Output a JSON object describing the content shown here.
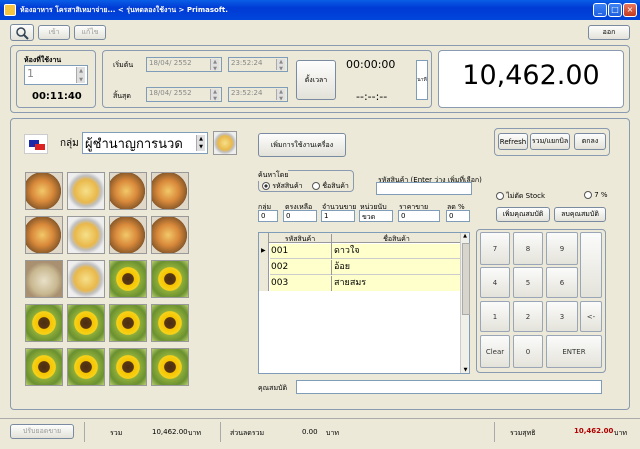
{
  "window": {
    "title": "ห้องอาหาร โครสาสิเหมาจ่าย... < รุ่นทดลองใช้งาน > Primasoft."
  },
  "toolbar": {
    "search_icon": "magnifier-icon",
    "btn1": "เข้า",
    "btn2": "แก้ไข",
    "exit": "ออก"
  },
  "room": {
    "label": "ห้องที่ใช้งาน",
    "value": "1",
    "time": "00:11:40"
  },
  "times": {
    "start_label": "เริ่มต้น",
    "start_date": "18/04/ 2552",
    "start_time": "23:52:24",
    "end_label": "สิ้นสุด",
    "end_date": "18/04/ 2552",
    "end_time": "23:52:24",
    "start_btn": "ตั้งเวลา",
    "elapsed": "00:00:00",
    "remain": "--:--:--",
    "unit": "นาที"
  },
  "total_display": "10,462.00",
  "group": {
    "label": "กลุ่ม",
    "value": "ผู้ชำนาญการนวด"
  },
  "service_btn": "เพิ่มการใช้งานเครื่อง",
  "right_btns": [
    "Refresh",
    "รวม/แยกบิล",
    "ตกลง"
  ],
  "search": {
    "label": "ค้นหาโดย",
    "opt1": "รหัสสินค้า",
    "opt2": "ชื่อสินค้า",
    "code_label": "รหัสสินค้า (Enter ว่าง เพิ่มที่เลือก)"
  },
  "stock": {
    "no_stock": "ไม่ตัด Stock",
    "vat": "7 %"
  },
  "fields": [
    {
      "label": "กลุ่ม",
      "value": "0"
    },
    {
      "label": "ตรงเหลือ",
      "value": "0"
    },
    {
      "label": "จำนวนขาย",
      "value": "1"
    },
    {
      "label": "หน่วยนับ",
      "value": "ขวด"
    },
    {
      "label": "ราคาขาย",
      "value": "0"
    },
    {
      "label": "ลด %",
      "value": "0"
    }
  ],
  "side_btns": [
    "เพิ่มคุณสมบัติ",
    "ลบคุณสมบัติ"
  ],
  "table": {
    "headers": [
      "รหัสสินค้า",
      "ชื่อสินค้า"
    ],
    "rows": [
      [
        "001",
        "ดาวใจ"
      ],
      [
        "002",
        "อ้อย"
      ],
      [
        "003",
        "สายสมร"
      ]
    ]
  },
  "keypad": [
    "7",
    "8",
    "9",
    "",
    "4",
    "5",
    "6",
    "",
    "1",
    "2",
    "3",
    "<-",
    "Clear",
    "0",
    "ENTER"
  ],
  "note": {
    "label": "คุณสมบัติ"
  },
  "status": {
    "btn": "ปรับยอดขาย",
    "total_label": "รวม",
    "total": "10,462.00",
    "unit1": "บาท",
    "discount_label": "ส่วนลดรวม",
    "discount": "0.00",
    "unit2": "บาท",
    "net_label": "รวมสุทธิ",
    "net": "10,462.00",
    "unit3": "บาท"
  },
  "colors": {
    "title": "#0046dc",
    "net": "#b00000"
  }
}
